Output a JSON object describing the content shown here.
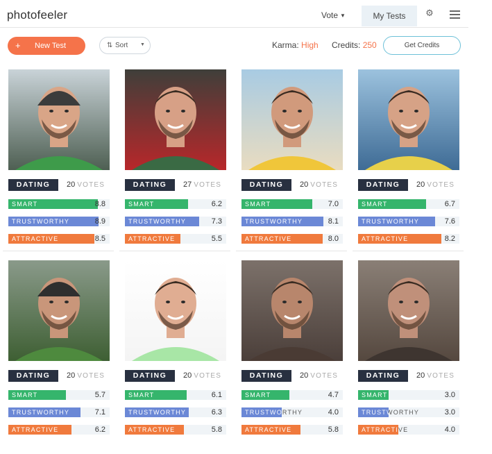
{
  "app": {
    "logo": "photofeeler",
    "nav": {
      "vote_label": "Vote",
      "mytests_label": "My Tests"
    },
    "toolbar": {
      "new_test_label": "New Test",
      "sort_label": "Sort",
      "karma_label": "Karma:",
      "karma_value": "High",
      "credits_label": "Credits:",
      "credits_value": "250",
      "get_credits_label": "Get Credits"
    }
  },
  "colors": {
    "accent": "#f5734a",
    "smart": "#35b56c",
    "trustworthy": "#6b88d6",
    "attractive": "#f07a3d",
    "badge": "#283040"
  },
  "tests": [
    {
      "category": "DATING",
      "votes_count": "20",
      "votes_word": "VOTES",
      "smart": "8.8",
      "trustworthy": "8.9",
      "attractive": "8.5",
      "photo": "beanie-mountain-selfie"
    },
    {
      "category": "DATING",
      "votes_count": "27",
      "votes_word": "VOTES",
      "smart": "6.2",
      "trustworthy": "7.3",
      "attractive": "5.5",
      "photo": "red-phonebox-selfie"
    },
    {
      "category": "DATING",
      "votes_count": "20",
      "votes_word": "VOTES",
      "smart": "7.0",
      "trustworthy": "8.1",
      "attractive": "8.0",
      "photo": "beach-selfie"
    },
    {
      "category": "DATING",
      "votes_count": "20",
      "votes_word": "VOTES",
      "smart": "6.7",
      "trustworthy": "7.6",
      "attractive": "8.2",
      "photo": "harbor-selfie"
    },
    {
      "category": "DATING",
      "votes_count": "20",
      "votes_word": "VOTES",
      "smart": "5.7",
      "trustworthy": "7.1",
      "attractive": "6.2",
      "photo": "green-hills-selfie"
    },
    {
      "category": "DATING",
      "votes_count": "20",
      "votes_word": "VOTES",
      "smart": "6.1",
      "trustworthy": "6.3",
      "attractive": "5.8",
      "photo": "white-background-portrait"
    },
    {
      "category": "DATING",
      "votes_count": "20",
      "votes_word": "VOTES",
      "smart": "4.7",
      "trustworthy": "4.0",
      "attractive": "5.8",
      "photo": "indoor-portrait-smirk"
    },
    {
      "category": "DATING",
      "votes_count": "20",
      "votes_word": "VOTES",
      "smart": "3.0",
      "trustworthy": "3.0",
      "attractive": "4.0",
      "photo": "indoor-portrait-glance"
    }
  ],
  "metric_labels": {
    "smart": "SMART",
    "trustworthy": "TRUSTWORTHY",
    "attractive": "ATTRACTIVE"
  }
}
